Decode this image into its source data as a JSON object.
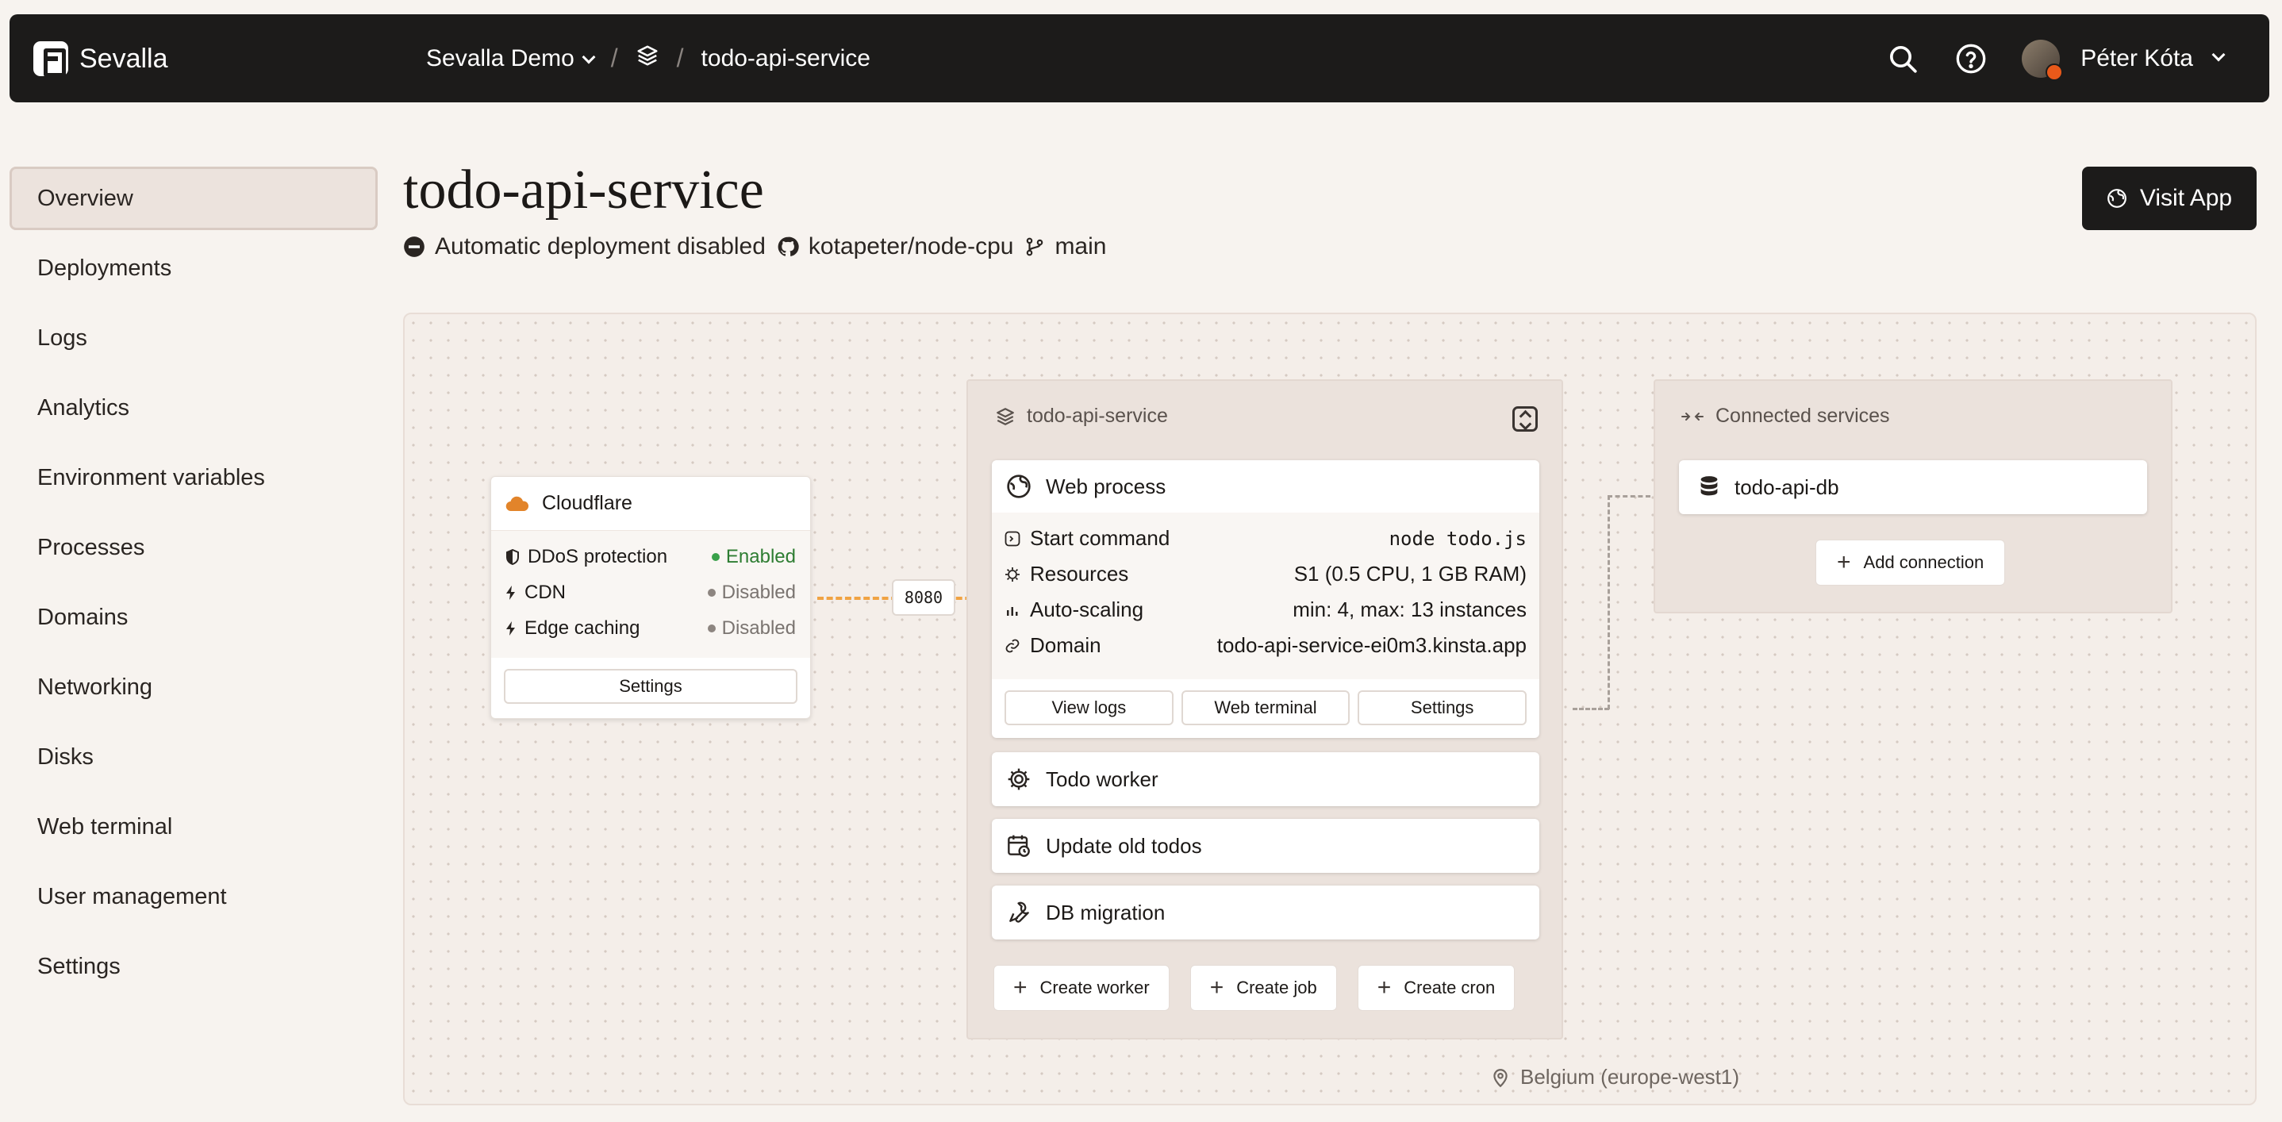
{
  "app": {
    "name": "Sevalla"
  },
  "breadcrumb": {
    "company": "Sevalla Demo",
    "app": "todo-api-service"
  },
  "user": {
    "name": "Péter Kóta"
  },
  "sidebar": {
    "items": [
      {
        "label": "Overview"
      },
      {
        "label": "Deployments"
      },
      {
        "label": "Logs"
      },
      {
        "label": "Analytics"
      },
      {
        "label": "Environment variables"
      },
      {
        "label": "Processes"
      },
      {
        "label": "Domains"
      },
      {
        "label": "Networking"
      },
      {
        "label": "Disks"
      },
      {
        "label": "Web terminal"
      },
      {
        "label": "User management"
      },
      {
        "label": "Settings"
      }
    ]
  },
  "header": {
    "title": "todo-api-service",
    "deploy_status": "Automatic deployment disabled",
    "repo": "kotapeter/node-cpu",
    "branch": "main",
    "visit_label": "Visit App"
  },
  "cloudflare": {
    "title": "Cloudflare",
    "rows": [
      {
        "label": "DDoS protection",
        "status": "Enabled"
      },
      {
        "label": "CDN",
        "status": "Disabled"
      },
      {
        "label": "Edge caching",
        "status": "Disabled"
      }
    ],
    "settings_label": "Settings"
  },
  "port": "8080",
  "service": {
    "title": "todo-api-service",
    "web": {
      "title": "Web process",
      "rows": [
        {
          "label": "Start command",
          "value": "node todo.js"
        },
        {
          "label": "Resources",
          "value": "S1 (0.5 CPU, 1 GB RAM)"
        },
        {
          "label": "Auto-scaling",
          "value": "min: 4, max: 13 instances"
        },
        {
          "label": "Domain",
          "value": "todo-api-service-ei0m3.kinsta.app"
        }
      ],
      "buttons": [
        "View logs",
        "Web terminal",
        "Settings"
      ]
    },
    "processes": [
      {
        "label": "Todo worker"
      },
      {
        "label": "Update old todos"
      },
      {
        "label": "DB migration"
      }
    ],
    "create": [
      "Create worker",
      "Create job",
      "Create cron"
    ]
  },
  "connected": {
    "title": "Connected services",
    "db": "todo-api-db",
    "add_label": "Add connection"
  },
  "region": "Belgium (europe-west1)",
  "colors": {
    "accent_orange": "#f0a343",
    "enabled_green": "#2e7d32",
    "dark": "#1c1b1a"
  }
}
